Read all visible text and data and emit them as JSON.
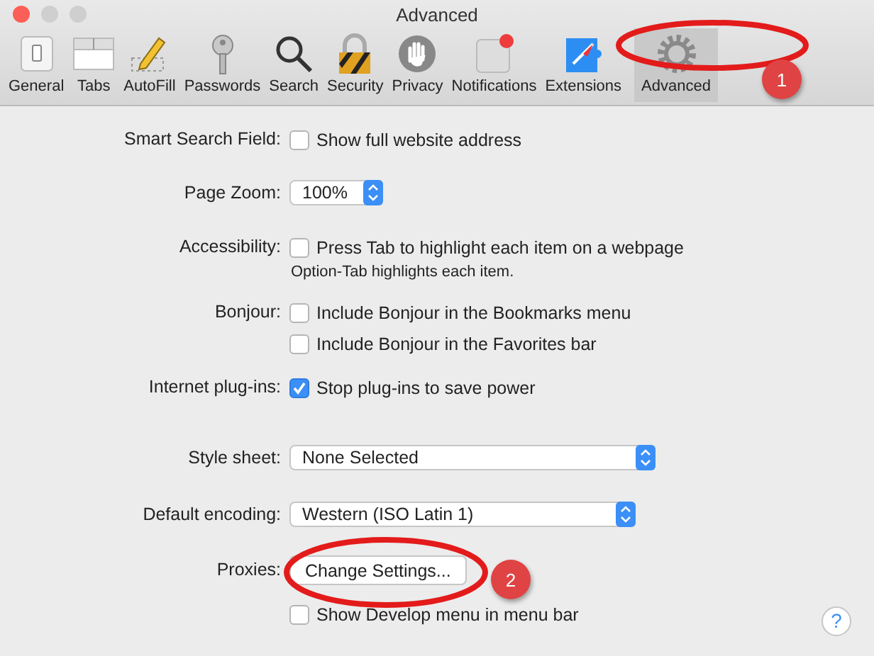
{
  "window": {
    "title": "Advanced"
  },
  "toolbar": [
    {
      "label": "General",
      "selected": false
    },
    {
      "label": "Tabs",
      "selected": false
    },
    {
      "label": "AutoFill",
      "selected": false
    },
    {
      "label": "Passwords",
      "selected": false
    },
    {
      "label": "Search",
      "selected": false
    },
    {
      "label": "Security",
      "selected": false
    },
    {
      "label": "Privacy",
      "selected": false
    },
    {
      "label": "Notifications",
      "selected": false
    },
    {
      "label": "Extensions",
      "selected": false
    },
    {
      "label": "Advanced",
      "selected": true
    }
  ],
  "settings": [
    {
      "label": "Smart Search Field:",
      "controls": [
        {
          "kind": "checkbox",
          "text": "Show full website address",
          "checked": false
        }
      ]
    },
    {
      "label": "Page Zoom:",
      "controls": [
        {
          "kind": "popup",
          "value": "100%"
        }
      ]
    },
    {
      "label": "Accessibility:",
      "controls": [
        {
          "kind": "checkbox",
          "text": "Press Tab to highlight each item on a webpage",
          "checked": false
        },
        {
          "kind": "note",
          "text": "Option-Tab highlights each item."
        }
      ]
    },
    {
      "label": "Bonjour:",
      "controls": [
        {
          "kind": "checkbox",
          "text": "Include Bonjour in the Bookmarks menu",
          "checked": false
        },
        {
          "kind": "checkbox",
          "text": "Include Bonjour in the Favorites bar",
          "checked": false
        }
      ]
    },
    {
      "label": "Internet plug-ins:",
      "controls": [
        {
          "kind": "checkbox",
          "text": "Stop plug-ins to save power",
          "checked": true
        }
      ]
    },
    {
      "label": "Style sheet:",
      "controls": [
        {
          "kind": "popup",
          "value": "None Selected"
        }
      ]
    },
    {
      "label": "Default encoding:",
      "controls": [
        {
          "kind": "popup",
          "value": "Western (ISO Latin 1)"
        }
      ]
    },
    {
      "label": "Proxies:",
      "controls": [
        {
          "kind": "button",
          "text": "Change Settings..."
        }
      ]
    },
    {
      "controls": [
        {
          "kind": "checkbox",
          "text": "Show Develop menu in menu bar",
          "checked": false
        }
      ]
    }
  ],
  "help": "?",
  "annotations": [
    {
      "label": "1"
    },
    {
      "label": "2"
    }
  ]
}
